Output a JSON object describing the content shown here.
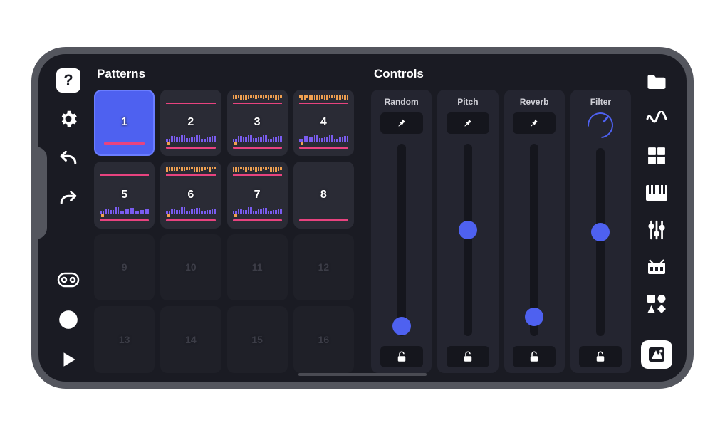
{
  "sections": {
    "patterns_title": "Patterns",
    "controls_title": "Controls"
  },
  "left_sidebar": {
    "help": "?",
    "items": [
      "settings",
      "undo",
      "redo",
      "recorder",
      "record",
      "play"
    ]
  },
  "right_sidebar": {
    "items": [
      "folder",
      "wave",
      "grid",
      "piano",
      "sliders",
      "drums",
      "shapes"
    ],
    "magic": "magic"
  },
  "patterns": [
    {
      "num": "1",
      "active": true,
      "filled": true,
      "variant": "solid"
    },
    {
      "num": "2",
      "active": false,
      "filled": true,
      "variant": "a"
    },
    {
      "num": "3",
      "active": false,
      "filled": true,
      "variant": "b"
    },
    {
      "num": "4",
      "active": false,
      "filled": true,
      "variant": "b"
    },
    {
      "num": "5",
      "active": false,
      "filled": true,
      "variant": "a"
    },
    {
      "num": "6",
      "active": false,
      "filled": true,
      "variant": "c"
    },
    {
      "num": "7",
      "active": false,
      "filled": true,
      "variant": "c"
    },
    {
      "num": "8",
      "active": false,
      "filled": true,
      "variant": "plain"
    },
    {
      "num": "9",
      "active": false,
      "filled": false
    },
    {
      "num": "10",
      "active": false,
      "filled": false
    },
    {
      "num": "11",
      "active": false,
      "filled": false
    },
    {
      "num": "12",
      "active": false,
      "filled": false
    },
    {
      "num": "13",
      "active": false,
      "filled": false
    },
    {
      "num": "14",
      "active": false,
      "filled": false
    },
    {
      "num": "15",
      "active": false,
      "filled": false
    },
    {
      "num": "16",
      "active": false,
      "filled": false
    }
  ],
  "controls": [
    {
      "label": "Random",
      "type": "slider",
      "value": 0.05,
      "pinned": true,
      "locked": false
    },
    {
      "label": "Pitch",
      "type": "slider",
      "value": 0.55,
      "pinned": true,
      "locked": false
    },
    {
      "label": "Reverb",
      "type": "slider",
      "value": 0.1,
      "pinned": true,
      "locked": false
    },
    {
      "label": "Filter",
      "type": "knob_slider",
      "value": 0.55,
      "knob": 0.8,
      "locked": false
    }
  ],
  "colors": {
    "accent": "#4e61f0",
    "bg": "#1a1b23",
    "pad": "#2a2b35",
    "pad_empty": "#1f2028"
  }
}
